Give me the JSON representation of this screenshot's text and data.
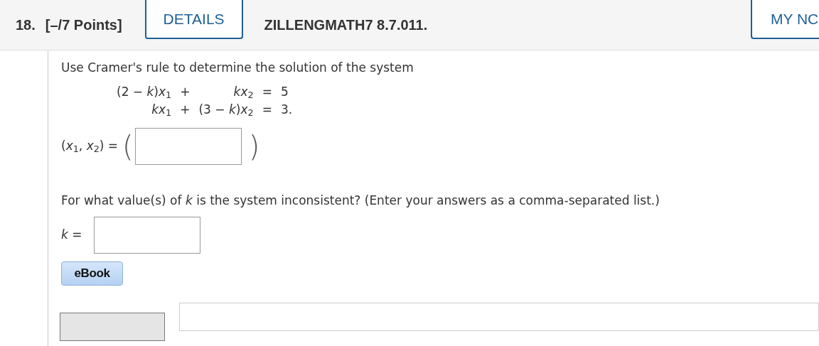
{
  "header": {
    "number": "18.",
    "points": "[–/7 Points]",
    "details_button": "DETAILS",
    "problem_id": "ZILLENGMATH7 8.7.011.",
    "right_button": "MY NC"
  },
  "question": {
    "prompt": "Use Cramer's rule to determine the solution of the system",
    "equations": [
      {
        "term1": "(2 − *k*)*x*$_{1}$",
        "op": "+",
        "term2": "*kx*$_{2}$",
        "eq": "=",
        "rhs": "5"
      },
      {
        "term1": "*kx*$_{1}$",
        "op": "+",
        "term2": "(3 − *k*)*x*$_{2}$",
        "eq": "=",
        "rhs": "3."
      }
    ],
    "answer_label": "(*x*$_{1}$, *x*$_{2}$) =",
    "open_paren": "(",
    "close_paren": ")",
    "prompt2": "For what value(s) of *k* is the system inconsistent? (Enter your answers as a comma-separated list.)",
    "k_label": "*k* ="
  },
  "ebook_button": "eBook"
}
